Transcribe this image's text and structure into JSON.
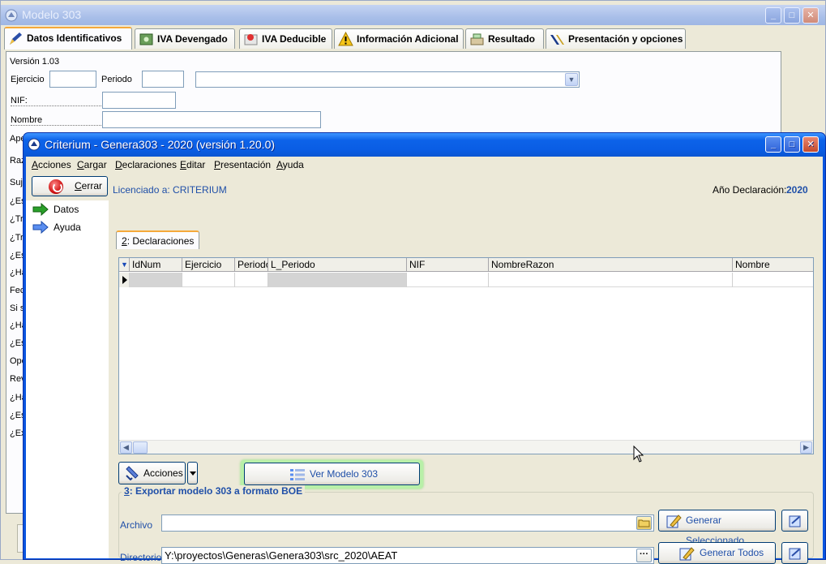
{
  "back_window": {
    "title": "Modelo 303",
    "tabs": [
      {
        "label": "Datos Identificativos",
        "icon": "pen-icon"
      },
      {
        "label": "IVA Devengado",
        "icon": "money-icon"
      },
      {
        "label": "IVA Deducible",
        "icon": "pin-icon"
      },
      {
        "label": "Información Adicional",
        "icon": "warning-icon"
      },
      {
        "label": "Resultado",
        "icon": "cash-register-icon"
      },
      {
        "label": "Presentación y opciones",
        "icon": "aeat-logo-icon"
      }
    ],
    "version": "Versión 1.03",
    "ejercicio_label": "Ejercicio",
    "periodo_label": "Periodo",
    "nif_label": "NIF:",
    "nombre_label": "Nombre",
    "left_fragments": [
      "Ape",
      "Raz",
      "Suje",
      "¿Es",
      "¿Tr",
      "¿Tr",
      "¿Es",
      "¿Ha",
      "Fec",
      "Si s",
      "¿Ha",
      "¿Es",
      "Opc",
      "Rev",
      "¿Ha",
      "¿Es",
      "¿Ex"
    ]
  },
  "front_window": {
    "title": "Criterium - Genera303 - 2020 (versión 1.20.0)",
    "menu": [
      {
        "accel": "A",
        "rest": "cciones"
      },
      {
        "accel": "C",
        "rest": "argar"
      },
      {
        "accel": "D",
        "rest": "eclaraciones"
      },
      {
        "accel": "E",
        "rest": "ditar"
      },
      {
        "accel": "P",
        "rest": "resentación"
      },
      {
        "accel": "A",
        "rest": "yuda"
      }
    ],
    "close_button": {
      "accel": "C",
      "rest": "errar"
    },
    "licensed": "Licenciado a: CRITERIUM",
    "year_label": "Año Declaración:",
    "year_value": "2020",
    "sidebar": [
      {
        "label": "Datos",
        "icon": "green-arrow-icon"
      },
      {
        "label": "Ayuda",
        "icon": "blue-arrow-icon"
      }
    ],
    "subtab": {
      "accel": "2",
      "rest": ": Declaraciones"
    },
    "grid_columns": [
      "IdNum",
      "Ejercicio",
      "Periodo",
      "L_Periodo",
      "NIF",
      "NombreRazon",
      "Nombre"
    ],
    "acciones_label": "Acciones",
    "ver_modelo_label": "Ver Modelo 303",
    "export_section": {
      "accel": "3",
      "rest": ": Exportar modelo 303 a formato BOE"
    },
    "archivo_label": "Archivo",
    "archivo_value": "",
    "directorio_label": "Directorio",
    "directorio_value": "Y:\\proyectos\\Generas\\Genera303\\src_2020\\AEAT",
    "generar_seleccionado": "Generar Seleccionado",
    "generar_todos": "Generar Todos"
  },
  "colors": {
    "xp_blue": "#0a5de4",
    "accent_blue": "#1f4fa8",
    "tab_highlight": "#f5a93a",
    "glow_green": "#b8f0a8"
  }
}
